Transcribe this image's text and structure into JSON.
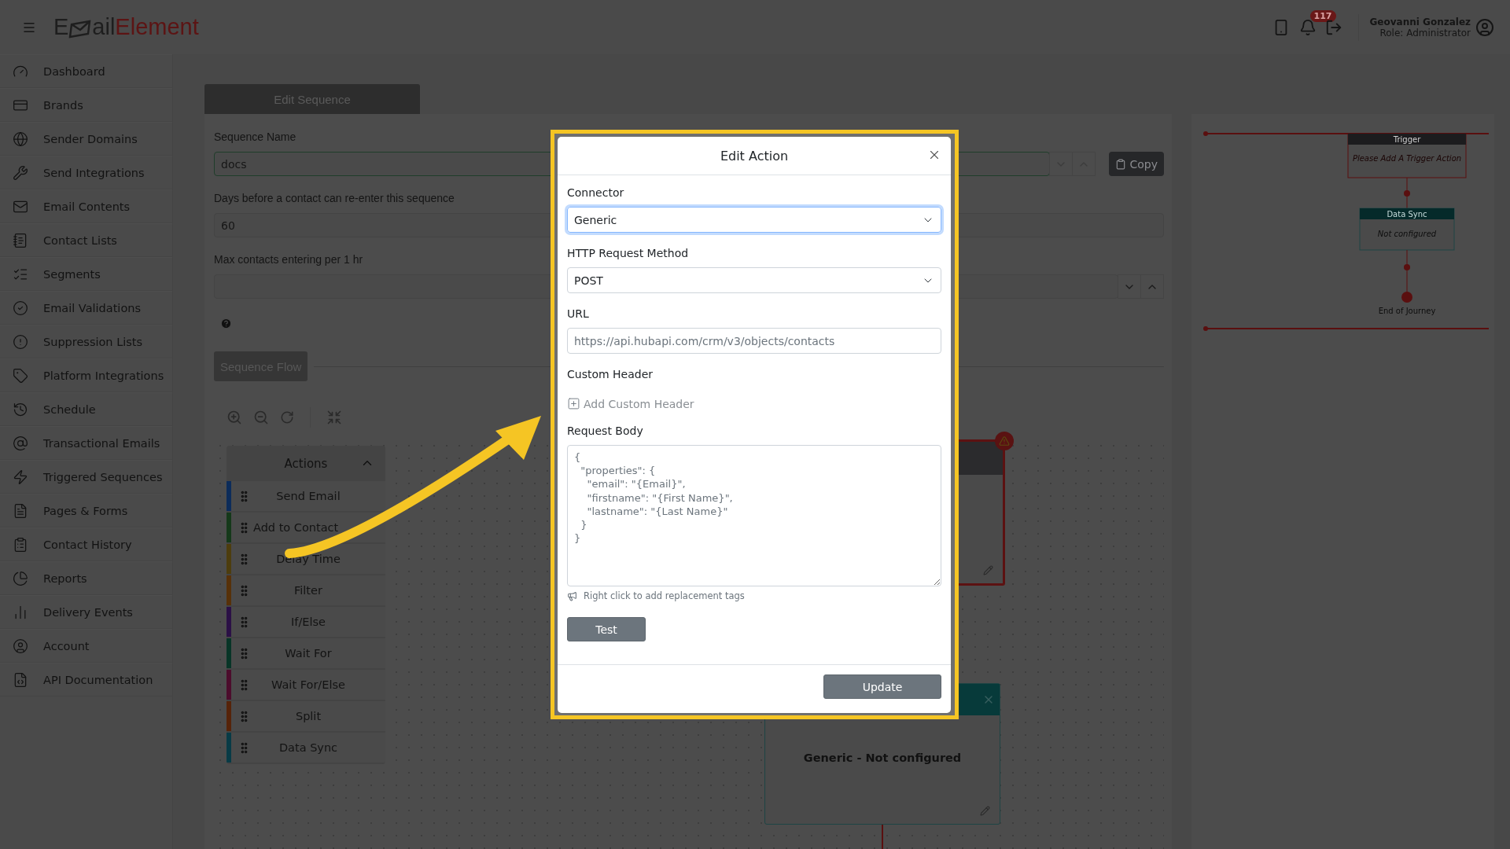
{
  "topbar": {
    "logo": [
      "E",
      "ail",
      "Element"
    ],
    "notification_count": "117",
    "user_name": "Geovanni Gonzalez",
    "user_role": "Role: Administrator"
  },
  "sidebar": {
    "items": [
      {
        "label": "Dashboard"
      },
      {
        "label": "Brands"
      },
      {
        "label": "Sender Domains"
      },
      {
        "label": "Send Integrations"
      },
      {
        "label": "Email Contents"
      },
      {
        "label": "Contact Lists"
      },
      {
        "label": "Segments"
      },
      {
        "label": "Email Validations"
      },
      {
        "label": "Suppression Lists"
      },
      {
        "label": "Platform Integrations"
      },
      {
        "label": "Schedule"
      },
      {
        "label": "Transactional Emails"
      },
      {
        "label": "Triggered Sequences"
      },
      {
        "label": "Pages & Forms"
      },
      {
        "label": "Contact History"
      },
      {
        "label": "Reports"
      },
      {
        "label": "Delivery Events"
      },
      {
        "label": "Account"
      },
      {
        "label": "API Documentation"
      }
    ]
  },
  "editor": {
    "tab": "Edit Sequence",
    "copy_button": "Copy",
    "flow_button": "Sequence Flow",
    "fields": [
      {
        "kind": "name",
        "label": "Sequence Name",
        "value": "docs"
      },
      {
        "kind": "plain",
        "label": "Days before a contact can re-enter this sequence",
        "value": "60"
      },
      {
        "kind": "number",
        "label": "Max contacts entering per 1 hr"
      }
    ]
  },
  "actions_panel": {
    "title": "Actions",
    "expanded": true,
    "items": [
      {
        "label": "Send Email",
        "color": "#0c2c5a"
      },
      {
        "label": "Add to Contact",
        "color": "#15391a"
      },
      {
        "label": "Delay Time",
        "color": "#4d3d0e"
      },
      {
        "label": "Filter",
        "color": "#573109"
      },
      {
        "label": "If/Else",
        "color": "#2b1046"
      },
      {
        "label": "Wait For",
        "color": "#083527"
      },
      {
        "label": "Wait For/Else",
        "color": "#4c0c2c"
      },
      {
        "label": "Split",
        "color": "#562309"
      },
      {
        "label": "Data Sync",
        "color": "#083b46"
      }
    ]
  },
  "canvas": {
    "nodes": [
      {
        "kind": "trigger",
        "warning": true
      },
      {
        "kind": "data_sync",
        "body": "Generic - Not configured"
      }
    ]
  },
  "minimap": {
    "trigger_title": "Trigger",
    "trigger_body": "Please Add A Trigger Action",
    "sync_title": "Data Sync",
    "sync_body": "Not configured",
    "end_label": "End of Journey"
  },
  "modal": {
    "title": "Edit Action",
    "fields": [
      {
        "kind": "select",
        "label": "Connector",
        "value": "Generic",
        "focused": true
      },
      {
        "kind": "select",
        "label": "HTTP Request Method",
        "value": "POST",
        "focused": false
      },
      {
        "kind": "input",
        "label": "URL",
        "value": "https://api.hubapi.com/crm/v3/objects/contacts",
        "focused": false
      }
    ],
    "custom_header_label": "Custom Header",
    "add_header_button": "Add Custom Header",
    "body_label": "Request Body",
    "body_value": "{\n  \"properties\": {\n    \"email\": \"{Email}\",\n    \"firstname\": \"{First Name}\",\n    \"lastname\": \"{Last Name}\"\n  }\n}",
    "hint": "Right click to add replacement tags",
    "test_button": "Test",
    "update_button": "Update"
  }
}
